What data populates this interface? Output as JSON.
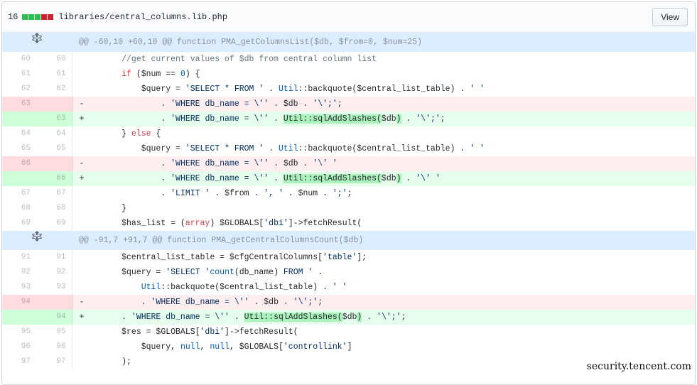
{
  "header": {
    "changes": "16",
    "diffstat": [
      "add",
      "add",
      "add",
      "del",
      "del"
    ],
    "path": "libraries/central_columns.lib.php",
    "view_label": "View"
  },
  "hunks": [
    {
      "header": "@@ -60,10 +60,10 @@ function PMA_getColumnsList($db, $from=0, $num=25)",
      "lines": [
        {
          "type": "ctx",
          "old": "60",
          "new": "60",
          "marker": "",
          "indent": "    ",
          "parts": [
            {
              "t": "//get current values of $db from central column list",
              "c": "c"
            }
          ]
        },
        {
          "type": "ctx",
          "old": "61",
          "new": "61",
          "marker": "",
          "indent": "    ",
          "parts": [
            {
              "t": "if",
              "c": "k"
            },
            {
              "t": " ($num == "
            },
            {
              "t": "0",
              "c": "n"
            },
            {
              "t": ") {"
            }
          ]
        },
        {
          "type": "ctx",
          "old": "62",
          "new": "62",
          "marker": "",
          "indent": "        ",
          "parts": [
            {
              "t": "$query = "
            },
            {
              "t": "'SELECT * FROM '",
              "c": "s"
            },
            {
              "t": " . "
            },
            {
              "t": "Util",
              "c": "n"
            },
            {
              "t": "::backquote($central_list_table) . "
            },
            {
              "t": "' '",
              "c": "s"
            }
          ]
        },
        {
          "type": "del",
          "old": "63",
          "new": "",
          "marker": "-",
          "indent": "            ",
          "parts": [
            {
              "t": ". "
            },
            {
              "t": "'WHERE db_name = \\''",
              "c": "s"
            },
            {
              "t": " . $db . "
            },
            {
              "t": "'\\';'",
              "c": "s"
            },
            {
              "t": ";"
            }
          ]
        },
        {
          "type": "add",
          "old": "",
          "new": "63",
          "marker": "+",
          "indent": "            ",
          "parts": [
            {
              "t": ". "
            },
            {
              "t": "'WHERE db_name = \\''",
              "c": "s"
            },
            {
              "t": " . "
            },
            {
              "t": "Util::sqlAddSlashes(",
              "c": "hl"
            },
            {
              "t": "$db"
            },
            {
              "t": ")",
              "c": "hl"
            },
            {
              "t": " . "
            },
            {
              "t": "'\\';'",
              "c": "s"
            },
            {
              "t": ";"
            }
          ]
        },
        {
          "type": "ctx",
          "old": "64",
          "new": "64",
          "marker": "",
          "indent": "    ",
          "parts": [
            {
              "t": "} "
            },
            {
              "t": "else",
              "c": "k"
            },
            {
              "t": " {"
            }
          ]
        },
        {
          "type": "ctx",
          "old": "65",
          "new": "65",
          "marker": "",
          "indent": "        ",
          "parts": [
            {
              "t": "$query = "
            },
            {
              "t": "'SELECT * FROM '",
              "c": "s"
            },
            {
              "t": " . "
            },
            {
              "t": "Util",
              "c": "n"
            },
            {
              "t": "::backquote($central_list_table) . "
            },
            {
              "t": "' '",
              "c": "s"
            }
          ]
        },
        {
          "type": "del",
          "old": "66",
          "new": "",
          "marker": "-",
          "indent": "            ",
          "parts": [
            {
              "t": ". "
            },
            {
              "t": "'WHERE db_name = \\''",
              "c": "s"
            },
            {
              "t": " . $db . "
            },
            {
              "t": "'\\' '",
              "c": "s"
            }
          ]
        },
        {
          "type": "add",
          "old": "",
          "new": "66",
          "marker": "+",
          "indent": "            ",
          "parts": [
            {
              "t": ". "
            },
            {
              "t": "'WHERE db_name = \\''",
              "c": "s"
            },
            {
              "t": " . "
            },
            {
              "t": "Util::sqlAddSlashes(",
              "c": "hl"
            },
            {
              "t": "$db"
            },
            {
              "t": ")",
              "c": "hl"
            },
            {
              "t": " . "
            },
            {
              "t": "'\\' '",
              "c": "s"
            }
          ]
        },
        {
          "type": "ctx",
          "old": "67",
          "new": "67",
          "marker": "",
          "indent": "            ",
          "parts": [
            {
              "t": ". "
            },
            {
              "t": "'LIMIT '",
              "c": "s"
            },
            {
              "t": " . $from . "
            },
            {
              "t": "', '",
              "c": "s"
            },
            {
              "t": " . $num . "
            },
            {
              "t": "';'",
              "c": "s"
            },
            {
              "t": ";"
            }
          ]
        },
        {
          "type": "ctx",
          "old": "68",
          "new": "68",
          "marker": "",
          "indent": "    ",
          "parts": [
            {
              "t": "}"
            }
          ]
        },
        {
          "type": "ctx",
          "old": "69",
          "new": "69",
          "marker": "",
          "indent": "    ",
          "parts": [
            {
              "t": "$has_list = ("
            },
            {
              "t": "array",
              "c": "k"
            },
            {
              "t": ") $GLOBALS["
            },
            {
              "t": "'dbi'",
              "c": "s"
            },
            {
              "t": "]->fetchResult("
            }
          ]
        }
      ]
    },
    {
      "header": "@@ -91,7 +91,7 @@ function PMA_getCentralColumnsCount($db)",
      "lines": [
        {
          "type": "ctx",
          "old": "91",
          "new": "91",
          "marker": "",
          "indent": "    ",
          "parts": [
            {
              "t": "$central_list_table = $cfgCentralColumns["
            },
            {
              "t": "'table'",
              "c": "s"
            },
            {
              "t": "];"
            }
          ]
        },
        {
          "type": "ctx",
          "old": "92",
          "new": "92",
          "marker": "",
          "indent": "    ",
          "parts": [
            {
              "t": "$query = "
            },
            {
              "t": "'SELECT '",
              "c": "s"
            },
            {
              "t": "count",
              "c": "n"
            },
            {
              "t": "(db_name) "
            },
            {
              "t": "FROM '",
              "c": "s"
            },
            {
              "t": " ."
            }
          ]
        },
        {
          "type": "ctx",
          "old": "93",
          "new": "93",
          "marker": "",
          "indent": "        ",
          "parts": [
            {
              "t": "Util",
              "c": "n"
            },
            {
              "t": "::backquote($central_list_table) . "
            },
            {
              "t": "' '",
              "c": "s"
            }
          ]
        },
        {
          "type": "del",
          "old": "94",
          "new": "",
          "marker": "-",
          "indent": "        ",
          "parts": [
            {
              "t": ". "
            },
            {
              "t": "'WHERE db_name = \\''",
              "c": "s"
            },
            {
              "t": " . $db . "
            },
            {
              "t": "'\\';'",
              "c": "s"
            },
            {
              "t": ";"
            }
          ]
        },
        {
          "type": "add",
          "old": "",
          "new": "94",
          "marker": "+",
          "indent": "    ",
          "parts": [
            {
              "t": ". "
            },
            {
              "t": "'WHERE db_name = \\''",
              "c": "s"
            },
            {
              "t": " . "
            },
            {
              "t": "Util::sqlAddSlashes(",
              "c": "hl"
            },
            {
              "t": "$db"
            },
            {
              "t": ")",
              "c": "hl"
            },
            {
              "t": " . "
            },
            {
              "t": "'\\';'",
              "c": "s"
            },
            {
              "t": ";"
            }
          ]
        },
        {
          "type": "ctx",
          "old": "95",
          "new": "95",
          "marker": "",
          "indent": "    ",
          "parts": [
            {
              "t": "$res = $GLOBALS["
            },
            {
              "t": "'dbi'",
              "c": "s"
            },
            {
              "t": "]->fetchResult("
            }
          ]
        },
        {
          "type": "ctx",
          "old": "96",
          "new": "96",
          "marker": "",
          "indent": "        ",
          "parts": [
            {
              "t": "$query, "
            },
            {
              "t": "null",
              "c": "n"
            },
            {
              "t": ", "
            },
            {
              "t": "null",
              "c": "n"
            },
            {
              "t": ", $GLOBALS["
            },
            {
              "t": "'controllink'",
              "c": "s"
            },
            {
              "t": "]"
            }
          ]
        },
        {
          "type": "ctx",
          "old": "97",
          "new": "97",
          "marker": "",
          "indent": "    ",
          "parts": [
            {
              "t": ");"
            }
          ]
        }
      ]
    }
  ],
  "watermark": "security.tencent.com",
  "expand_icon": "unfold-icon"
}
